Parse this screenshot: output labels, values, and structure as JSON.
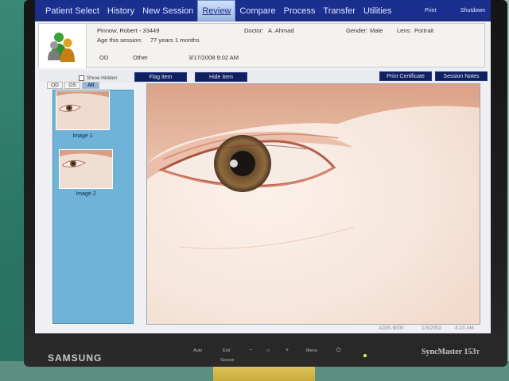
{
  "menu": {
    "items": [
      "Patient Select",
      "History",
      "New Session",
      "Review",
      "Compare",
      "Process",
      "Transfer",
      "Utilities"
    ],
    "active": "Review",
    "print_label": "Print",
    "shutdown_label": "Shutdown"
  },
  "patient": {
    "name_id": "Pinnow, Robert - 33449",
    "age_label": "Age this session:",
    "age_value": "77 years 1 months",
    "doctor_label": "Doctor:",
    "doctor_value": "A. Ahmad",
    "gender_label": "Gender:",
    "gender_value": "Male",
    "lens_label": "Lens:",
    "lens_value": "Portrait",
    "eye": "OD",
    "type": "Other",
    "datetime": "3/17/2008 9:02 AM"
  },
  "toolbar": {
    "show_hidden_label": "Show Hidden",
    "flag_item_label": "Flag Item",
    "hide_item_label": "Hide Item",
    "print_certificate_label": "Print Certificate",
    "session_notes_label": "Session Notes"
  },
  "eye_tabs": {
    "od": "OD",
    "os": "OS",
    "all": "All",
    "active": "All"
  },
  "thumbnails": [
    {
      "label": "Image 1"
    },
    {
      "label": "Image 2"
    }
  ],
  "status_bar": {
    "device": "ADIS-9000",
    "date": "1/3/2002",
    "time": "4:23 AM"
  },
  "monitor": {
    "brand": "SAMSUNG",
    "model": "SyncMaster 153",
    "model_suffix": "T",
    "controls": [
      "Auto",
      "Exit",
      "Menu",
      "Source"
    ]
  },
  "colors": {
    "menu_bg": "#1b2f92",
    "button_dark": "#0f2060",
    "thumb_panel": "#6fb4d8"
  }
}
